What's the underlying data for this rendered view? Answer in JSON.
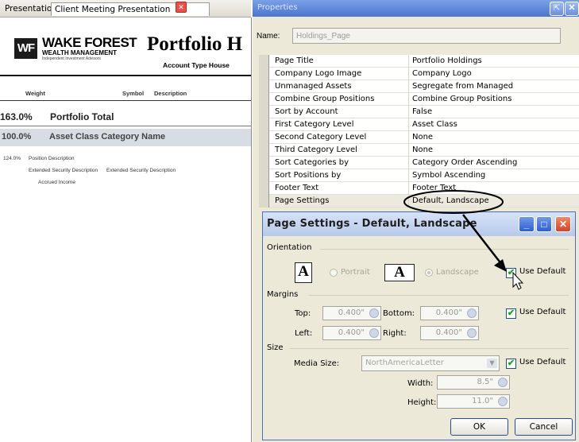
{
  "tabs": {
    "presentation": "Presentation",
    "client_meeting": "Client Meeting Presentation"
  },
  "report": {
    "logo_letters": "WF",
    "logo_name": "WAKE FOREST",
    "logo_sub": "WEALTH MANAGEMENT",
    "logo_tagline": "Independent Investment Advisors",
    "title": "Portfolio H",
    "account_type": "Account Type House",
    "columns": {
      "weight": "Weight",
      "symbol": "Symbol",
      "description": "Description"
    },
    "total": {
      "pct": "163.0%",
      "label": "Portfolio Total"
    },
    "category": {
      "pct": "100.0%",
      "label": "Asset Class Category Name"
    },
    "position": {
      "pct": "124.0%",
      "description": "Position Description",
      "ext1": "Extended Security Description",
      "ext2": "Extended Security Description",
      "accrued": "Accrued Income"
    }
  },
  "properties": {
    "title": "Properties",
    "name_label": "Name:",
    "name_value": "Holdings_Page",
    "rows": [
      {
        "key": "Page Title",
        "value": "Portfolio Holdings"
      },
      {
        "key": "Company Logo Image",
        "value": "Company Logo"
      },
      {
        "key": "Unmanaged Assets",
        "value": "Segregate from Managed"
      },
      {
        "key": "Combine Group Positions",
        "value": "Combine Group Positions"
      },
      {
        "key": "Sort by Account",
        "value": "False"
      },
      {
        "key": "First Category Level",
        "value": "Asset Class"
      },
      {
        "key": "Second Category Level",
        "value": "None"
      },
      {
        "key": "Third Category Level",
        "value": "None"
      },
      {
        "key": "Sort Categories by",
        "value": "Category Order Ascending"
      },
      {
        "key": "Sort Positions by",
        "value": "Symbol Ascending"
      },
      {
        "key": "Footer Text",
        "value": "Footer Text"
      },
      {
        "key": "Page Settings",
        "value": "Default, Landscape"
      }
    ]
  },
  "dialog": {
    "title": "Page Settings - Default, Landscape",
    "orientation_label": "Orientation",
    "portrait": "Portrait",
    "landscape": "Landscape",
    "use_default": "Use Default",
    "margins_label": "Margins",
    "top_label": "Top:",
    "top_value": "0.400\"",
    "bottom_label": "Bottom:",
    "bottom_value": "0.400\"",
    "left_label": "Left:",
    "left_value": "0.400\"",
    "right_label": "Right:",
    "right_value": "0.400\"",
    "size_label": "Size",
    "media_label": "Media Size:",
    "media_value": "NorthAmericaLetter",
    "width_label": "Width:",
    "width_value": "8.5\"",
    "height_label": "Height:",
    "height_value": "11.0\"",
    "ok": "OK",
    "cancel": "Cancel",
    "glyph": "A"
  },
  "colors": {
    "title_blue": "#4b75cf",
    "dialog_title": "#c4d4ef",
    "category_band": "#d8dde3",
    "check_green": "#21a121"
  }
}
